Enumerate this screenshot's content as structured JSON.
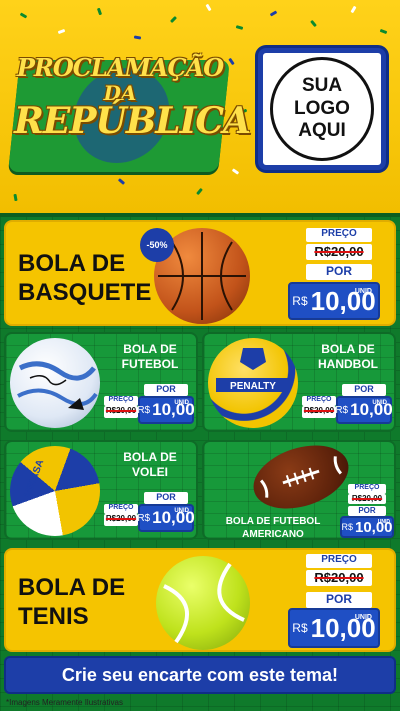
{
  "header": {
    "title_line1": "PROCLAMAÇÃO",
    "title_line2": "DA",
    "title_line3": "REPÚBLICA",
    "logo_line1": "SUA",
    "logo_line2": "LOGO",
    "logo_line3": "AQUI"
  },
  "colors": {
    "brand_blue": "#1d3ea8",
    "brand_green": "#0f7a2b",
    "brand_yellow": "#f5c400"
  },
  "labels": {
    "preco": "PREÇO",
    "por": "POR",
    "currency": "R$",
    "unit": "UNID"
  },
  "products": {
    "basquete": {
      "name_line1": "BOLA DE",
      "name_line2": "BASQUETE",
      "discount": "-50%",
      "old_price": "R$20,00",
      "new_price": "10,00"
    },
    "futebol": {
      "name_line1": "BOLA DE",
      "name_line2": "FUTEBOL",
      "old_price": "R$20,00",
      "new_price": "10,00"
    },
    "handbol": {
      "name_line1": "BOLA DE",
      "name_line2": "HANDBOL",
      "ball_brand": "PENALTY",
      "old_price": "R$20,00",
      "new_price": "10,00"
    },
    "volei": {
      "name_line1": "BOLA DE",
      "name_line2": "VOLEI",
      "ball_brand": "MIKASA",
      "old_price": "R$20,00",
      "new_price": "10,00"
    },
    "americano": {
      "name_line1": "BOLA DE FUTEBOL",
      "name_line2": "AMERICANO",
      "old_price": "R$20,00",
      "new_price": "10,00"
    },
    "tenis": {
      "name_line1": "BOLA DE",
      "name_line2": "TENIS",
      "old_price": "R$20,00",
      "new_price": "10,00"
    }
  },
  "cta": "Crie seu encarte com este tema!",
  "footnote": "*Imagens Meramente Ilustrativas"
}
